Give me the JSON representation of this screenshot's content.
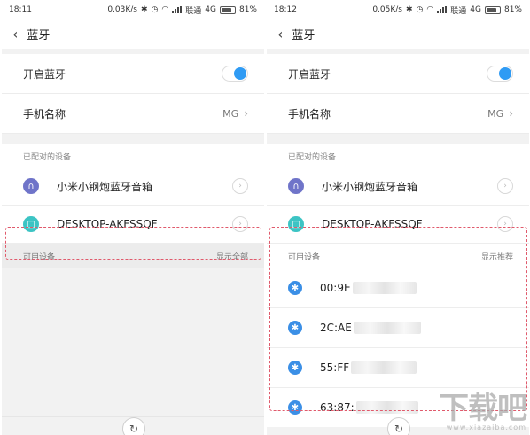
{
  "left": {
    "status": {
      "time": "18:11",
      "speed": "0.03K/s",
      "carrier": "联通",
      "network": "4G",
      "battery": "81%"
    },
    "title": "蓝牙",
    "bluetooth_label": "开启蓝牙",
    "bluetooth_on": true,
    "phone_name_label": "手机名称",
    "phone_name_value": "MG",
    "paired_header": "已配对的设备",
    "paired": [
      {
        "name": "小米小钢炮蓝牙音箱",
        "icon": "headphones-icon"
      },
      {
        "name": "DESKTOP-AKFSSQF",
        "icon": "desktop-icon"
      }
    ],
    "available_header": "可用设备",
    "available_action": "显示全部"
  },
  "right": {
    "status": {
      "time": "18:12",
      "speed": "0.05K/s",
      "carrier": "联通",
      "network": "4G",
      "battery": "81%"
    },
    "title": "蓝牙",
    "bluetooth_label": "开启蓝牙",
    "bluetooth_on": true,
    "phone_name_label": "手机名称",
    "phone_name_value": "MG",
    "paired_header": "已配对的设备",
    "paired": [
      {
        "name": "小米小钢炮蓝牙音箱",
        "icon": "headphones-icon"
      },
      {
        "name": "DESKTOP-AKFSSQF",
        "icon": "desktop-icon"
      }
    ],
    "available_header": "可用设备",
    "available_action": "显示推荐",
    "available": [
      {
        "name": "00:9E"
      },
      {
        "name": "2C:AE"
      },
      {
        "name": "55:FF"
      },
      {
        "name": "63:87:"
      }
    ]
  },
  "watermark": {
    "main": "下载吧",
    "sub": "www.xiazaiba.com"
  },
  "colors": {
    "accent": "#2f9bf4",
    "highlight_border": "#e05a6c",
    "speaker_icon": "#6f74c9",
    "desktop_icon": "#3cc4c4",
    "bluetooth_icon": "#3b8fe6"
  }
}
